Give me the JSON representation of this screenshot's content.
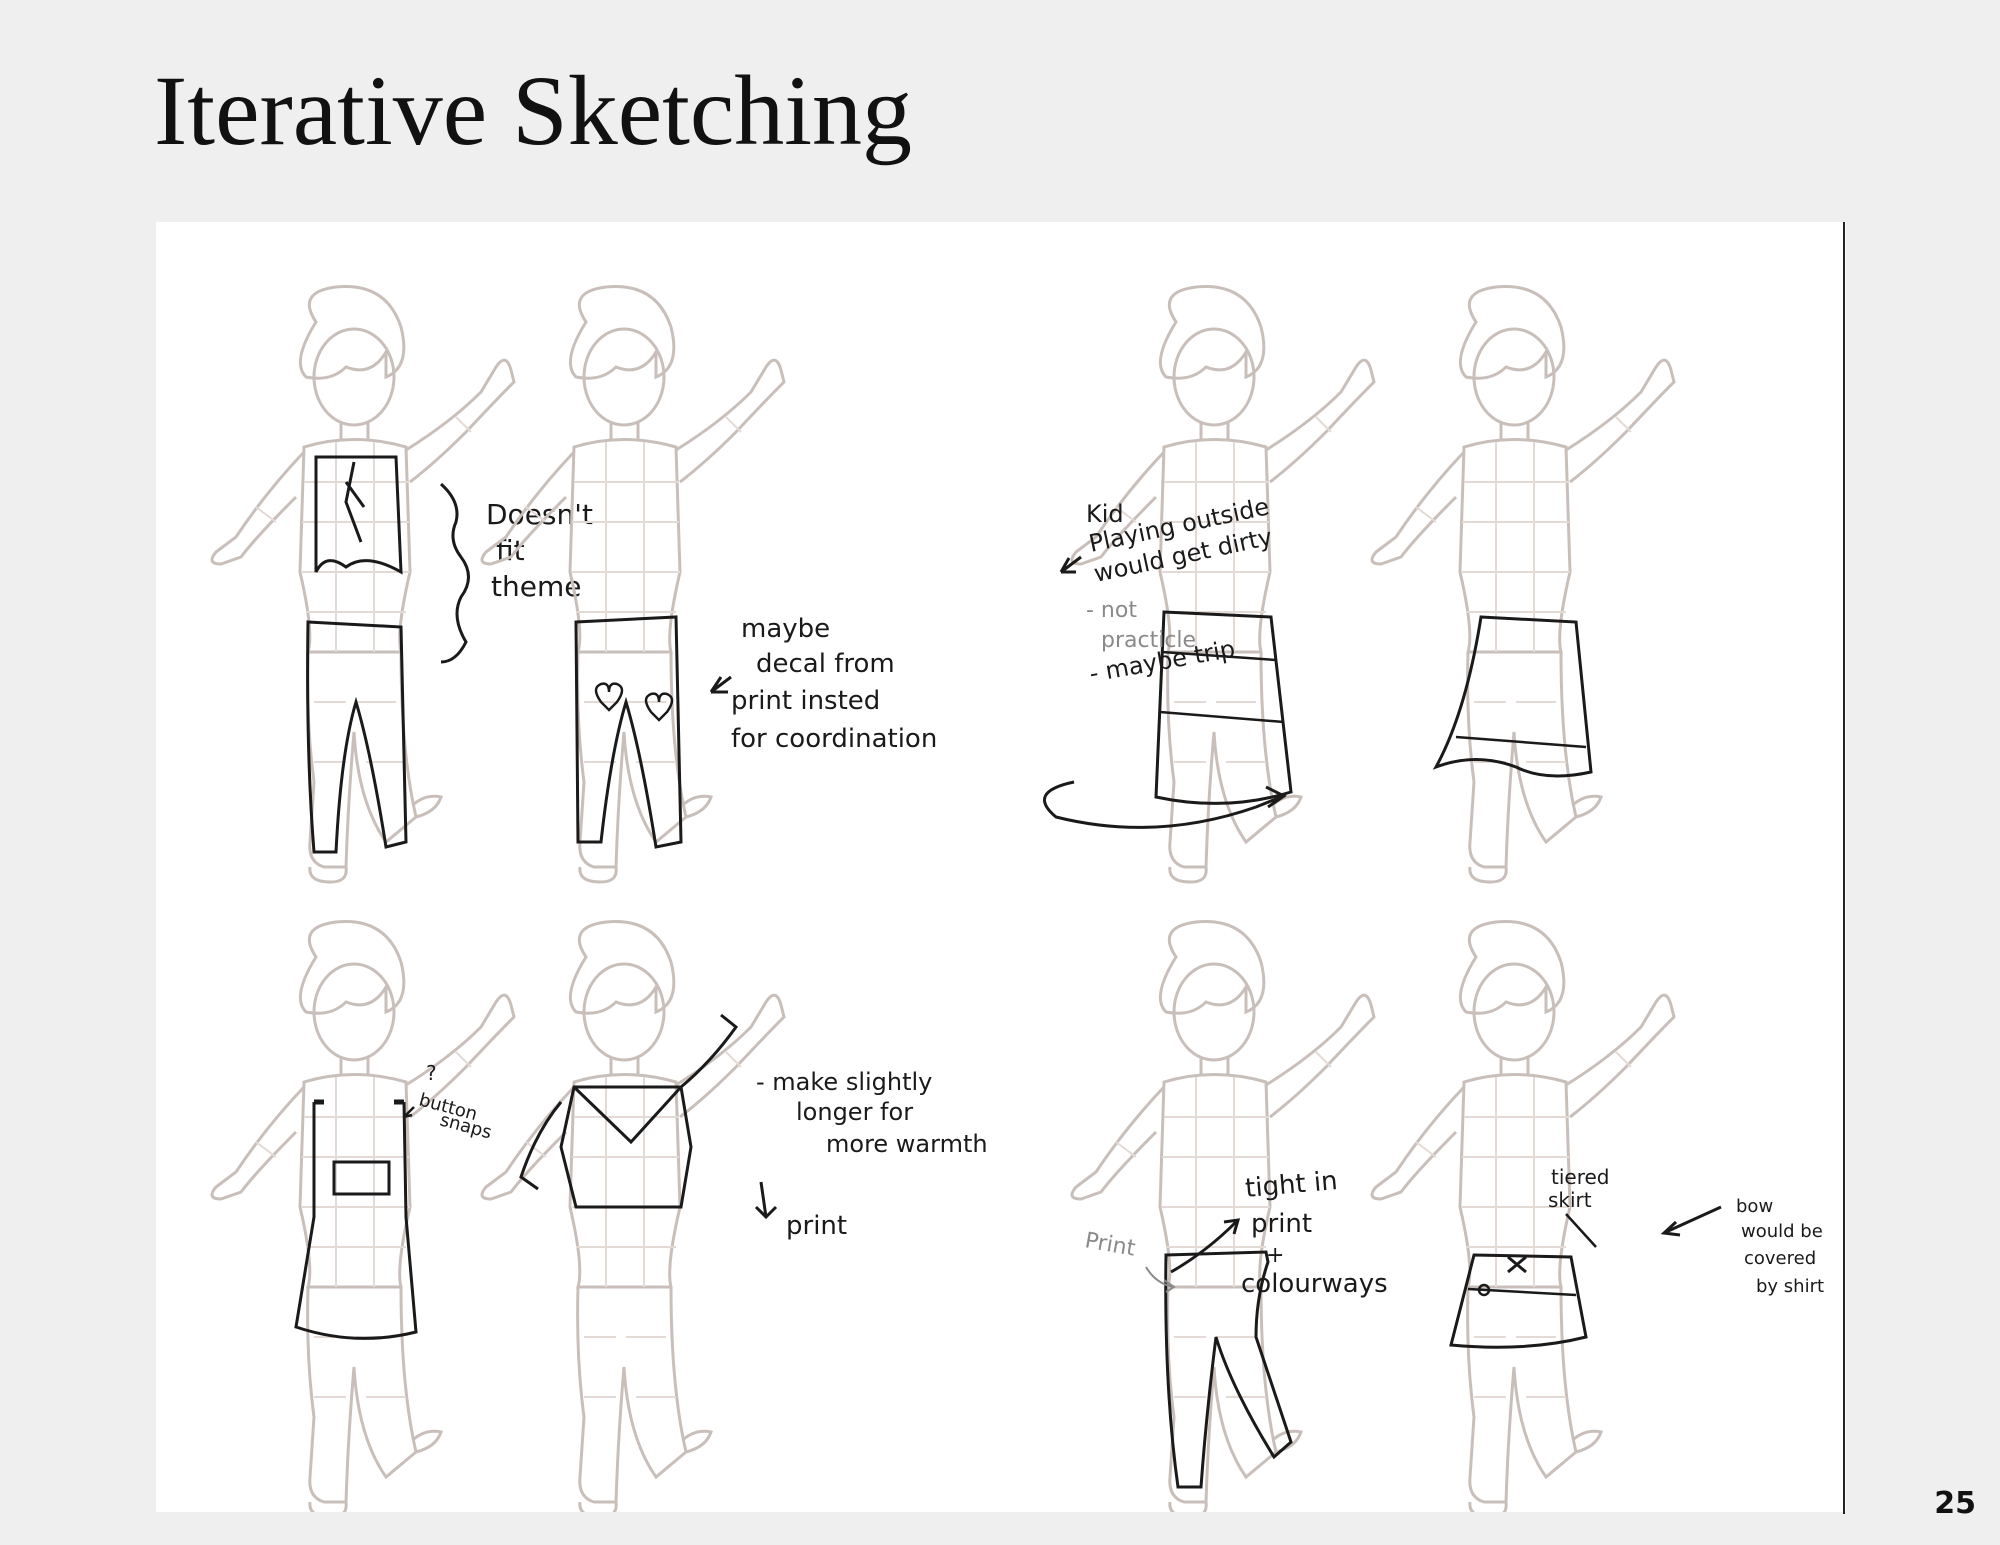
{
  "slide": {
    "title": "Iterative Sketching",
    "page_number": "25"
  },
  "annotations": {
    "doesnt_fit": [
      "Doesn't",
      "fit",
      "theme"
    ],
    "maybe_decal": [
      "maybe",
      "decal from",
      "print insted",
      "for coordination"
    ],
    "kid_playing": [
      "Kid",
      "Playing outside",
      "would get dirty"
    ],
    "not_practicle": [
      "- not",
      "practicle"
    ],
    "maybe_trip": "- maybe trip",
    "button_snaps": [
      "?",
      "button",
      "snaps"
    ],
    "make_longer": [
      "- make slightly",
      "longer for",
      "more warmth"
    ],
    "print_arrow": "print",
    "print_label": "Print",
    "tight_in_print": [
      "tight in",
      "print",
      "+",
      "colourways"
    ],
    "tiered_skirt": [
      "tiered",
      "skirt"
    ],
    "bow_covered": [
      "bow",
      "would be",
      "covered",
      "by shirt"
    ]
  },
  "colors": {
    "background": "#efefef",
    "panel": "#ffffff",
    "figure_outline": "#c9bfba",
    "figure_grid": "#e3dad6",
    "pencil": "#1a1a1a"
  }
}
